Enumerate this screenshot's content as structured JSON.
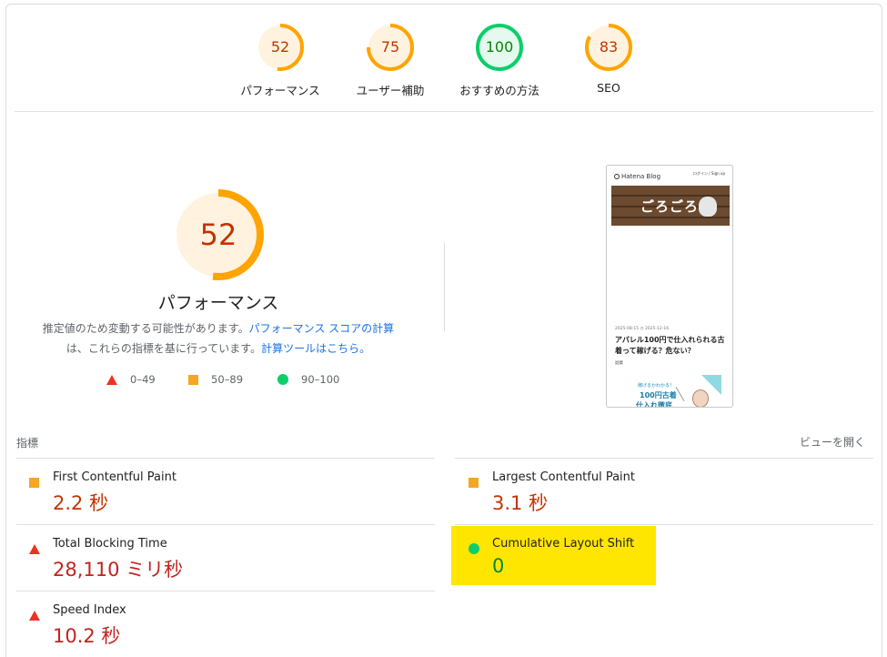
{
  "gauges": [
    {
      "score": "52",
      "label": "パフォーマンス",
      "fraction": 0.52,
      "color": "#ffa400",
      "bg": "#fff3e0",
      "text_color": "#c33300"
    },
    {
      "score": "75",
      "label": "ユーザー補助",
      "fraction": 0.75,
      "color": "#ffa400",
      "bg": "#fff3e0",
      "text_color": "#c33300"
    },
    {
      "score": "100",
      "label": "おすすめの方法",
      "fraction": 1.0,
      "color": "#0cce6b",
      "bg": "#e6f9ee",
      "text_color": "#008800"
    },
    {
      "score": "83",
      "label": "SEO",
      "fraction": 0.83,
      "color": "#ffa400",
      "bg": "#fff3e0",
      "text_color": "#c33300"
    }
  ],
  "main_gauge": {
    "score": "52",
    "fraction": 0.52,
    "title": "パフォーマンス",
    "color": "#ffa400",
    "bg": "#fff3e0"
  },
  "description": {
    "line1_text": "推定値のため変動する可能性があります。",
    "line1_link": "パフォーマンス スコアの計算",
    "line2_text": "は、これらの指標を基に行っています。",
    "line2_link": "計算ツールはこちら。"
  },
  "legend": {
    "fail": "0–49",
    "average": "50–89",
    "pass": "90–100"
  },
  "thumbnail": {
    "site_name": "Hatena Blog",
    "signin": "ログイン / Sign up",
    "hero_logo": "ごろごろ",
    "meta": "2025-08-15 ◷ 2025-12-16",
    "title": "アパレル100円で仕入れられる古着って稼げる？危ない？",
    "category": "副業",
    "banner_line1": "稼げるかわかる！",
    "banner_line2": "100円古着",
    "banner_line3": "仕入れ徹底"
  },
  "metrics_header": "指標",
  "open_view": "ビューを開く",
  "metrics": [
    {
      "name": "First Contentful Paint",
      "value": "2.2 秒",
      "status": "average"
    },
    {
      "name": "Largest Contentful Paint",
      "value": "3.1 秒",
      "status": "average"
    },
    {
      "name": "Total Blocking Time",
      "value": "28,110 ミリ秒",
      "status": "fail"
    },
    {
      "name": "Cumulative Layout Shift",
      "value": "0",
      "status": "pass"
    },
    {
      "name": "Speed Index",
      "value": "10.2 秒",
      "status": "fail"
    }
  ],
  "status_colors": {
    "fail": "#eb3323",
    "average": "#f5a623",
    "pass": "#0cce6b",
    "highlight": "#ffe600"
  }
}
